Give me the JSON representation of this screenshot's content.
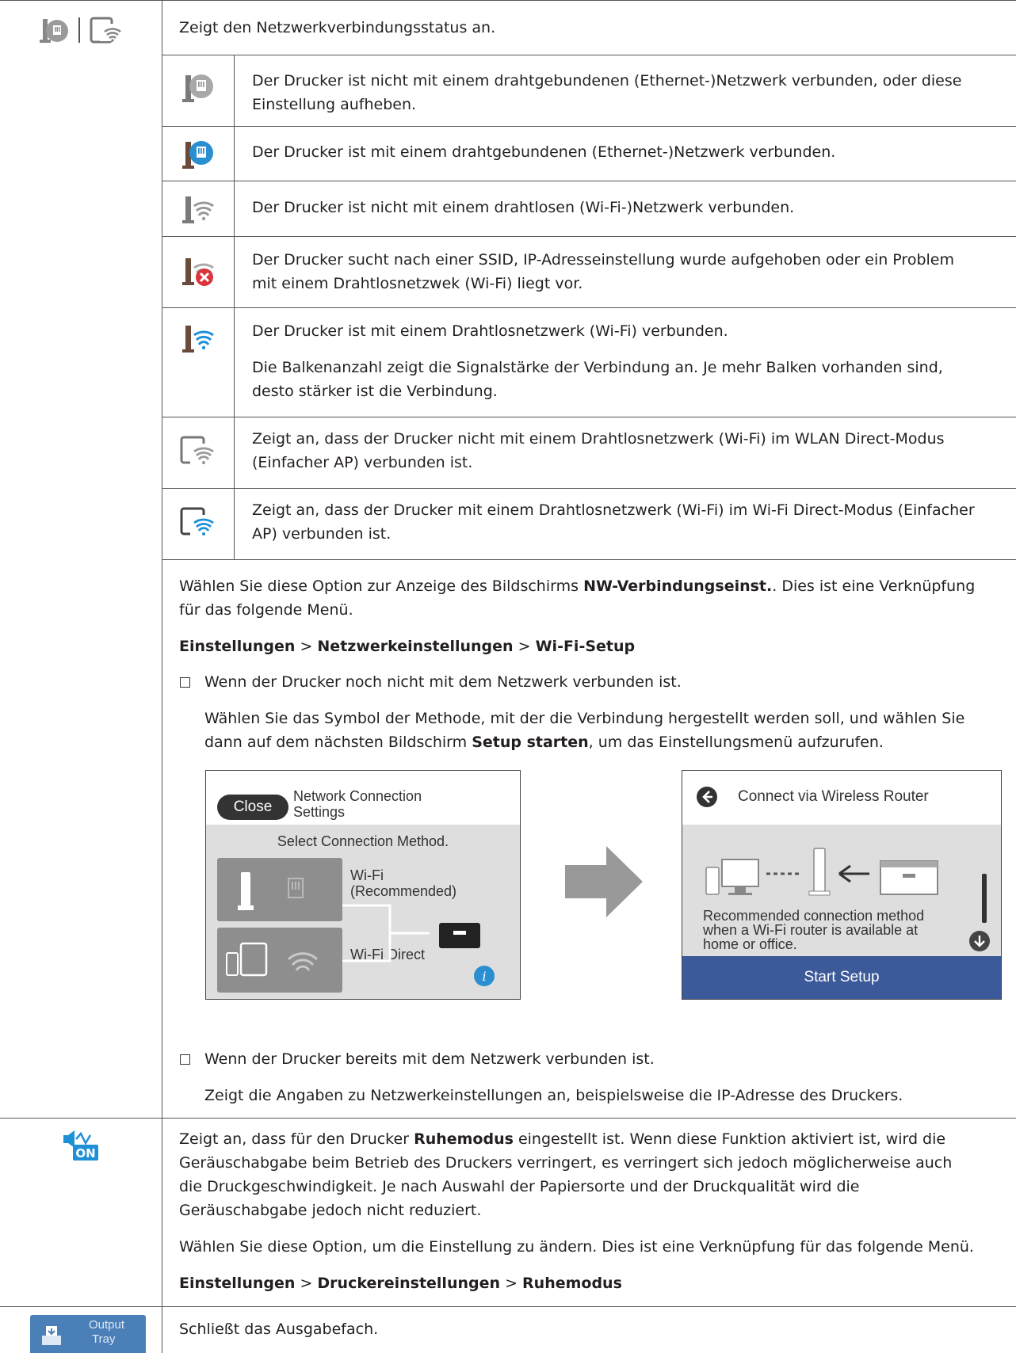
{
  "network_section": {
    "header": "Zeigt den Netzwerkverbindungsstatus an.",
    "states": [
      {
        "icon": "wired-disconnected-icon",
        "lines": [
          "Der Drucker ist nicht mit einem drahtgebundenen (Ethernet-)Netzwerk verbunden, oder diese",
          "Einstellung aufheben."
        ]
      },
      {
        "icon": "wired-connected-icon",
        "lines": [
          "Der Drucker ist mit einem drahtgebundenen (Ethernet-)Netzwerk verbunden."
        ]
      },
      {
        "icon": "wifi-disconnected-icon",
        "lines": [
          "Der Drucker ist nicht mit einem drahtlosen (Wi-Fi-)Netzwerk verbunden."
        ]
      },
      {
        "icon": "wifi-error-icon",
        "lines": [
          "Der Drucker sucht nach einer SSID, IP-Adresseinstellung wurde aufgehoben oder ein Problem",
          "mit einem Drahtlosnetzwek (Wi-Fi) liegt vor."
        ]
      },
      {
        "icon": "wifi-connected-icon",
        "lines": [
          "Der Drucker ist mit einem Drahtlosnetzwerk (Wi-Fi) verbunden."
        ],
        "extra_lines": [
          "Die Balkenanzahl zeigt die Signalstärke der Verbindung an. Je mehr Balken vorhanden sind,",
          "desto stärker ist die Verbindung."
        ]
      },
      {
        "icon": "wifi-direct-disconnected-icon",
        "lines": [
          "Zeigt an, dass der Drucker nicht mit einem Drahtlosnetzwerk (Wi-Fi) im WLAN Direct-Modus",
          "(Einfacher AP) verbunden ist."
        ]
      },
      {
        "icon": "wifi-direct-connected-icon",
        "lines": [
          "Zeigt an, dass der Drucker mit einem Drahtlosnetzwerk (Wi-Fi) im Wi-Fi Direct-Modus (Einfacher",
          "AP) verbunden ist."
        ]
      }
    ],
    "select_text": {
      "p1_before": "Wählen Sie diese Option zur Anzeige des Bildschirms ",
      "p1_bold": "NW-Verbindungseinst.",
      "p1_after": ". Dies ist eine Verknüpfung",
      "p1_line2": "für das folgende Menü."
    },
    "menu_path": {
      "a": "Einstellungen",
      "sep": ">",
      "b": "Netzwerkeinstellungen",
      "c": "Wi-Fi-Setup"
    },
    "bullet1": {
      "title": "Wenn der Drucker noch nicht mit dem Netzwerk verbunden ist.",
      "line1": "Wählen Sie das Symbol der Methode, mit der die Verbindung hergestellt werden soll, und wählen Sie",
      "line2_before": "dann auf dem nächsten Bildschirm ",
      "line2_bold": "Setup starten",
      "line2_after": ", um das Einstellungsmenü aufzurufen."
    },
    "screen1": {
      "close": "Close",
      "title_l1": "Network Connection",
      "title_l2": "Settings",
      "subtitle": "Select Connection Method.",
      "opt1_l1": "Wi-Fi",
      "opt1_l2": "(Recommended)",
      "opt2": "Wi-Fi Direct"
    },
    "screen2": {
      "title": "Connect via Wireless Router",
      "desc_l1": "Recommended connection method",
      "desc_l2": "when a Wi-Fi router is available at",
      "desc_l3": "home or office.",
      "button": "Start Setup"
    },
    "bullet2": {
      "title": "Wenn der Drucker bereits mit dem Netzwerk verbunden ist.",
      "text": "Zeigt die Angaben zu Netzwerkeinstellungen an, beispielsweise die IP-Adresse des Druckers."
    }
  },
  "quiet_section": {
    "icon_label": "ON",
    "p1_l1_before": "Zeigt an, dass für den Drucker ",
    "p1_l1_bold": "Ruhemodus",
    "p1_l1_after": " eingestellt ist. Wenn diese Funktion aktiviert ist, wird die",
    "p1_l2": "Geräuschabgabe beim Betrieb des Druckers verringert, es verringert sich jedoch möglicherweise auch",
    "p1_l3": "die Druckgeschwindigkeit. Je nach Auswahl der Papiersorte und der Druckqualität wird die",
    "p1_l4": "Geräuschabgabe jedoch nicht reduziert.",
    "p2": "Wählen Sie diese Option, um die Einstellung zu ändern. Dies ist eine Verknüpfung für das folgende Menü.",
    "path": {
      "a": "Einstellungen",
      "sep": ">",
      "b": "Druckereinstellungen",
      "c": "Ruhemodus"
    }
  },
  "output_section": {
    "icon_l1": "Output",
    "icon_l2": "Tray",
    "text": "Schließt das Ausgabefach."
  }
}
